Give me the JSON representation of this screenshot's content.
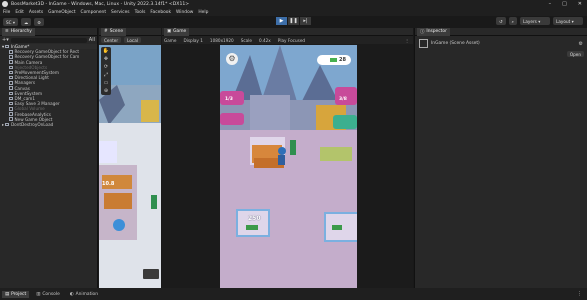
{
  "window": {
    "title": "BossMarket3D - InGame - Windows, Mac, Linux - Unity 2022.3.14f1* <DX11>"
  },
  "menu": [
    "File",
    "Edit",
    "Assets",
    "GameObject",
    "Component",
    "Services",
    "Tools",
    "Facebook",
    "Window",
    "Help"
  ],
  "toolbar": {
    "account": "SC"
  },
  "right_toolbar": {
    "layers_label": "Layers",
    "layout_label": "Layout"
  },
  "hierarchy": {
    "tab_label": "Hierarchy",
    "search_label": "All",
    "scene_name": "InGame*",
    "items": [
      {
        "label": "Recovery GameObject for Rect",
        "dim": false
      },
      {
        "label": "Recovery GameObject for Cam",
        "dim": false
      },
      {
        "label": "Main Camera",
        "dim": false
      },
      {
        "label": "InjectedObjects",
        "dim": true
      },
      {
        "label": "PreMovementSystem",
        "dim": false
      },
      {
        "label": "Directional Light",
        "dim": false
      },
      {
        "label": "Managers",
        "dim": false
      },
      {
        "label": "Canvas",
        "dim": false
      },
      {
        "label": "EventSystem",
        "dim": false
      },
      {
        "label": "DM_cam1",
        "dim": false
      },
      {
        "label": "Easy Save 3 Manager",
        "dim": false
      },
      {
        "label": "Global Volume",
        "dim": true
      },
      {
        "label": "FirebaseAnalytics",
        "dim": false
      },
      {
        "label": "New Game Object",
        "dim": false
      }
    ],
    "dont_destroy": "DontDestroyOnLoad"
  },
  "scene": {
    "tab_label": "Scene",
    "center_label": "Center",
    "local_label": "Local"
  },
  "game": {
    "tab_label": "Game",
    "mode_label": "Game",
    "display_label": "Display 1",
    "resolution_label": "1080x1920",
    "scale_label": "Scale",
    "scale_value": "0.42x",
    "focus_label": "Play Focused",
    "hud_cash": "28",
    "hud_left_tag": "1/3",
    "hud_right_tag": "3/8",
    "floor_price": "250",
    "scene_price_tag": "10.8"
  },
  "inspector": {
    "tab_label": "Inspector",
    "object_label": "InGame (Scene Asset)",
    "open_label": "Open"
  },
  "bottom": {
    "project_label": "Project",
    "console_label": "Console",
    "animation_label": "Animation"
  }
}
